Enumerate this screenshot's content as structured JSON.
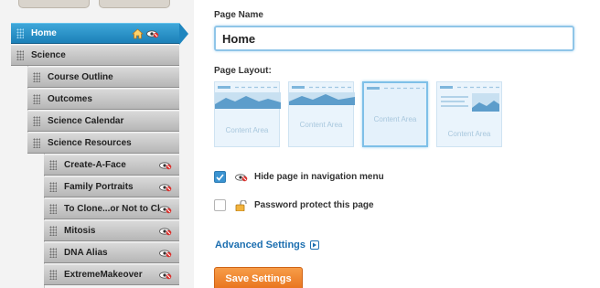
{
  "sidebar": {
    "items": [
      {
        "label": "Home",
        "level": 0,
        "selected": true,
        "icons": [
          "home-icon",
          "hidden-eye-icon"
        ]
      },
      {
        "label": "Science",
        "level": 0
      },
      {
        "label": "Course Outline",
        "level": 1
      },
      {
        "label": "Outcomes",
        "level": 1
      },
      {
        "label": "Science Calendar",
        "level": 1
      },
      {
        "label": "Science Resources",
        "level": 1
      },
      {
        "label": "Create-A-Face",
        "level": 2,
        "icon": "hidden-eye-icon"
      },
      {
        "label": "Family Portraits",
        "level": 2,
        "icon": "hidden-eye-icon"
      },
      {
        "label": "To Clone...or Not to Clone",
        "level": 2,
        "icon": "hidden-eye-icon"
      },
      {
        "label": "Mitosis",
        "level": 2,
        "icon": "hidden-eye-icon"
      },
      {
        "label": "DNA Alias",
        "level": 2,
        "icon": "hidden-eye-icon"
      },
      {
        "label": "ExtremeMakeover",
        "level": 2,
        "icon": "hidden-eye-icon"
      }
    ]
  },
  "form": {
    "page_name_label": "Page Name",
    "page_name_value": "Home",
    "page_layout_label": "Page Layout:",
    "layouts": [
      {
        "content_label": "Content Area",
        "selected": false
      },
      {
        "content_label": "Content Area",
        "selected": false
      },
      {
        "content_label": "Content Area",
        "selected": true
      },
      {
        "content_label": "Content Area",
        "selected": false
      }
    ],
    "hide_page": {
      "label": "Hide page in navigation menu",
      "checked": true,
      "icon": "hidden-eye-icon"
    },
    "password": {
      "label": "Password protect this page",
      "checked": false,
      "icon": "lock-icon"
    },
    "advanced_link": "Advanced Settings",
    "save_button": "Save Settings"
  },
  "colors": {
    "accent_blue": "#1f86bf",
    "save_orange": "#f0842c",
    "link_blue": "#1d6fb0"
  }
}
